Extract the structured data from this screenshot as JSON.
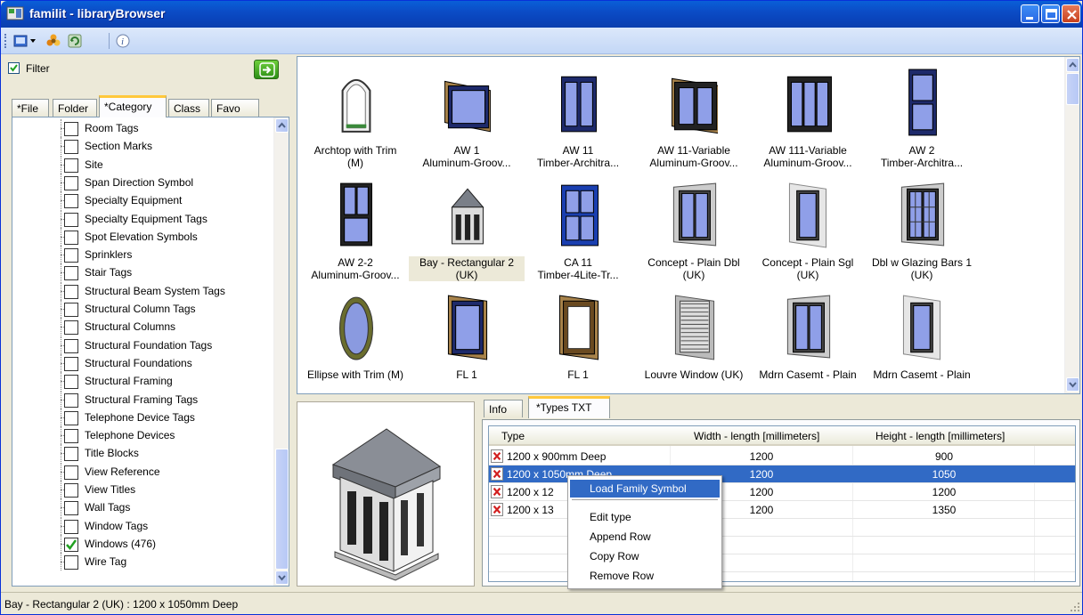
{
  "window": {
    "title": "familit - libraryBrowser"
  },
  "toolbar": {
    "icons": [
      "open-menu-icon",
      "settings-flower-icon",
      "refresh-icon",
      "info-icon"
    ]
  },
  "left": {
    "filter_label": "Filter",
    "filter_checked": true,
    "tabs": [
      {
        "label": "*File"
      },
      {
        "label": "Folder"
      },
      {
        "label": "*Category",
        "active": true
      },
      {
        "label": "Class"
      },
      {
        "label": "Favo"
      }
    ],
    "tree_items": [
      {
        "label": "Room Tags",
        "checked": false
      },
      {
        "label": "Section Marks",
        "checked": false
      },
      {
        "label": "Site",
        "checked": false
      },
      {
        "label": "Span Direction Symbol",
        "checked": false
      },
      {
        "label": "Specialty Equipment",
        "checked": false
      },
      {
        "label": "Specialty Equipment Tags",
        "checked": false
      },
      {
        "label": "Spot Elevation Symbols",
        "checked": false
      },
      {
        "label": "Sprinklers",
        "checked": false
      },
      {
        "label": "Stair Tags",
        "checked": false
      },
      {
        "label": "Structural Beam System Tags",
        "checked": false
      },
      {
        "label": "Structural Column Tags",
        "checked": false
      },
      {
        "label": "Structural Columns",
        "checked": false
      },
      {
        "label": "Structural Foundation Tags",
        "checked": false
      },
      {
        "label": "Structural Foundations",
        "checked": false
      },
      {
        "label": "Structural Framing",
        "checked": false
      },
      {
        "label": "Structural Framing Tags",
        "checked": false
      },
      {
        "label": "Telephone Device Tags",
        "checked": false
      },
      {
        "label": "Telephone Devices",
        "checked": false
      },
      {
        "label": "Title Blocks",
        "checked": false
      },
      {
        "label": "View Reference",
        "checked": false
      },
      {
        "label": "View Titles",
        "checked": false
      },
      {
        "label": "Wall Tags",
        "checked": false
      },
      {
        "label": "Window Tags",
        "checked": false
      },
      {
        "label": "Windows (476)",
        "checked": true
      },
      {
        "label": "Wire Tag",
        "checked": false
      }
    ]
  },
  "gallery": {
    "items": [
      {
        "line1": "Archtop with Trim",
        "line2": "(M)",
        "kind": "arch"
      },
      {
        "line1": "AW 1",
        "line2": "Aluminum-Groov...",
        "kind": "wide"
      },
      {
        "line1": "AW 11",
        "line2": "Timber-Architra...",
        "kind": "double"
      },
      {
        "line1": "AW 11-Variable",
        "line2": "Aluminum-Groov...",
        "kind": "widedouble"
      },
      {
        "line1": "AW 111-Variable",
        "line2": "Aluminum-Groov...",
        "kind": "triple"
      },
      {
        "line1": "AW 2",
        "line2": "Timber-Architra...",
        "kind": "tall2"
      },
      {
        "line1": "AW 2-2",
        "line2": "Aluminum-Groov...",
        "kind": "tall22"
      },
      {
        "line1": "Bay - Rectangular 2",
        "line2": "(UK)",
        "kind": "bay",
        "selected": true
      },
      {
        "line1": "CA 11",
        "line2": "Timber-4Lite-Tr...",
        "kind": "grid"
      },
      {
        "line1": "Concept - Plain Dbl",
        "line2": "(UK)",
        "kind": "concept2"
      },
      {
        "line1": "Concept - Plain Sgl",
        "line2": "(UK)",
        "kind": "concept1"
      },
      {
        "line1": "Dbl w Glazing Bars 1",
        "line2": "(UK)",
        "kind": "glazing"
      },
      {
        "line1": "Ellipse with Trim (M)",
        "line2": "",
        "kind": "ellipse"
      },
      {
        "line1": "FL 1",
        "line2": "",
        "kind": "fl1"
      },
      {
        "line1": "FL 1",
        "line2": "",
        "kind": "fl1b"
      },
      {
        "line1": "Louvre Window (UK)",
        "line2": "",
        "kind": "louvre"
      },
      {
        "line1": "Mdrn Casemt - Plain",
        "line2": "",
        "kind": "casemt2"
      },
      {
        "line1": "Mdrn Casemt - Plain",
        "line2": "",
        "kind": "casemt1"
      }
    ]
  },
  "detail": {
    "tabs": [
      {
        "label": "Info"
      },
      {
        "label": "*Types TXT",
        "active": true
      }
    ],
    "columns": [
      "Type",
      "Width - length [millimeters]",
      "Height - length [millimeters]"
    ],
    "rows": [
      {
        "type": "1200 x 900mm Deep",
        "width": "1200",
        "height": "900"
      },
      {
        "type": "1200 x 1050mm Deep",
        "width": "1200",
        "height": "1050",
        "selected": true
      },
      {
        "type": "1200 x 12",
        "width": "1200",
        "height": "1200"
      },
      {
        "type": "1200 x 13",
        "width": "1200",
        "height": "1350"
      }
    ]
  },
  "context_menu": {
    "items": [
      {
        "label": "Load Family Symbol",
        "highlighted": true
      },
      {
        "label": "Edit type"
      },
      {
        "label": "Append Row"
      },
      {
        "label": "Copy Row"
      },
      {
        "label": "Remove Row"
      }
    ]
  },
  "status": {
    "text": "Bay - Rectangular 2 (UK) : 1200 x 1050mm Deep"
  },
  "colors": {
    "title_bar": "#0a5fd8",
    "selection": "#316ac5",
    "tab_accent": "#ffc83c"
  }
}
